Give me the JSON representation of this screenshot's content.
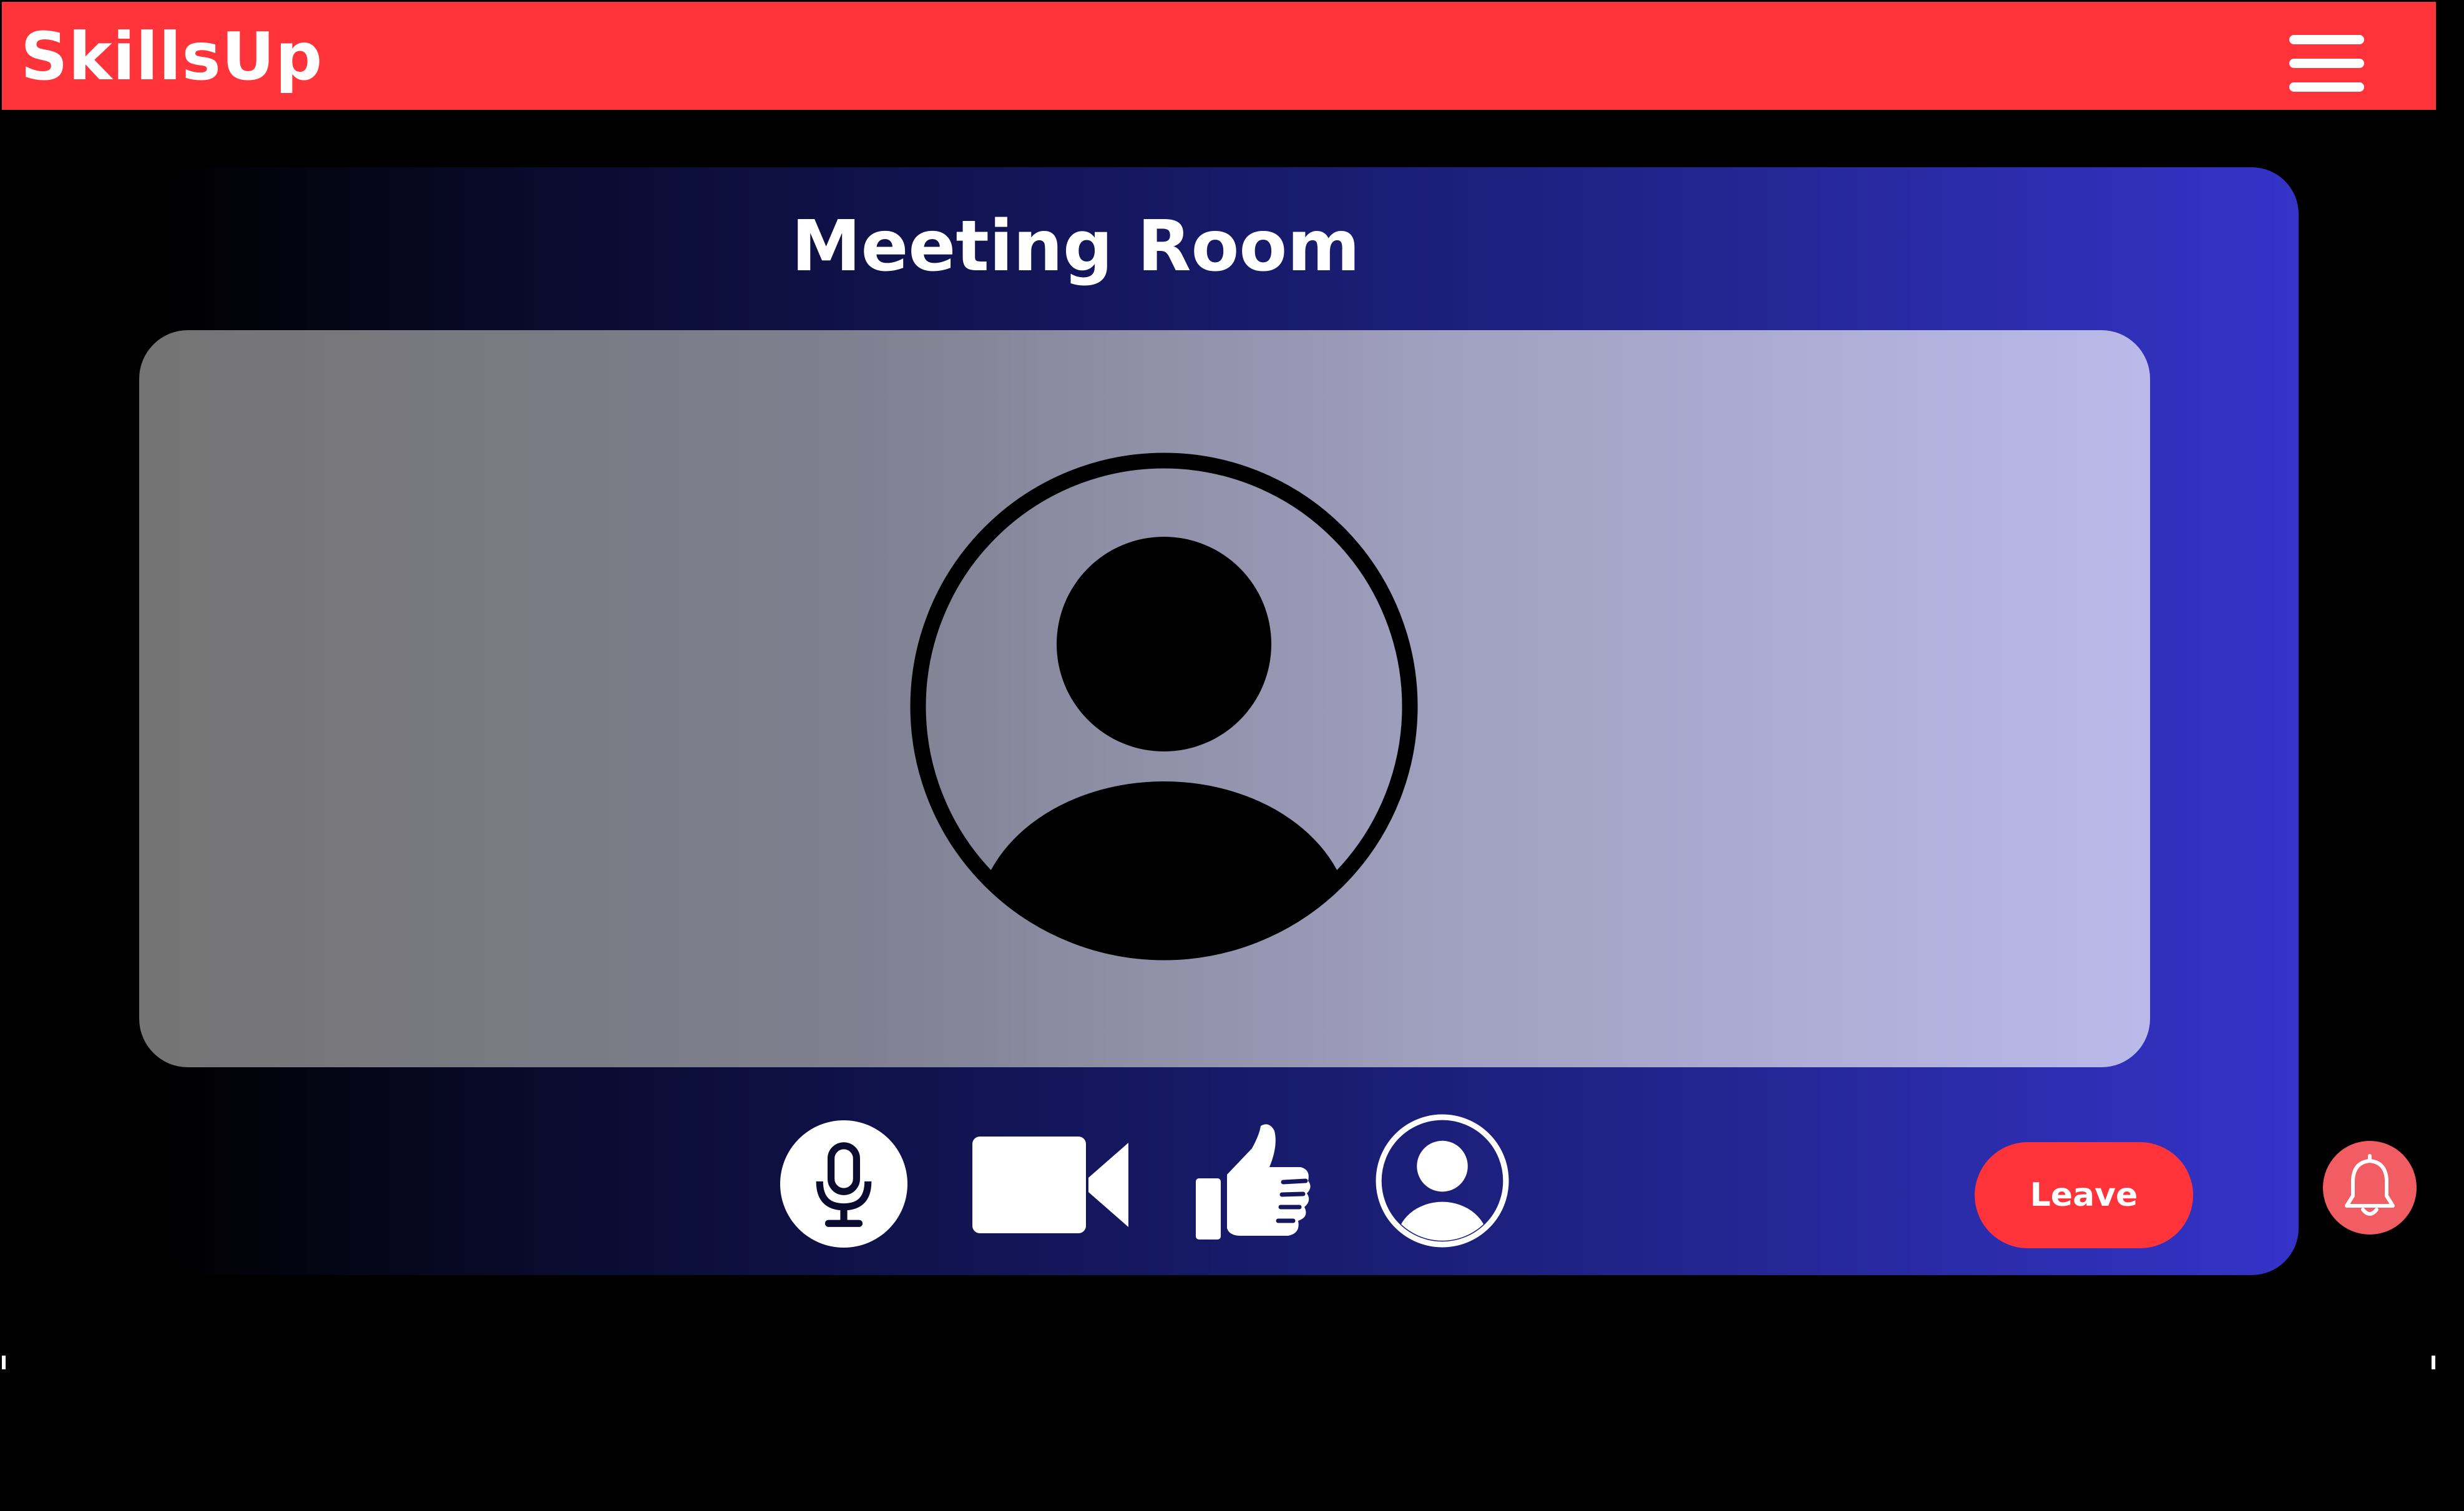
{
  "header": {
    "brand": "SkillsUp",
    "menu_icon": "hamburger-menu-icon"
  },
  "room": {
    "title": "Meeting Room",
    "participant_icon": "user-avatar-icon"
  },
  "controls": {
    "icons": [
      "microphone-icon",
      "video-camera-icon",
      "thumbs-up-icon",
      "user-profile-icon"
    ],
    "leave_label": "Leave",
    "notification_icon": "bell-icon"
  },
  "colors": {
    "header": "#ff343a",
    "accent": "#ff343a",
    "panel_start": "#000000",
    "panel_end": "#3533c9",
    "video_start": "#747474",
    "video_end": "#babaea",
    "notification": "#f25c63"
  }
}
